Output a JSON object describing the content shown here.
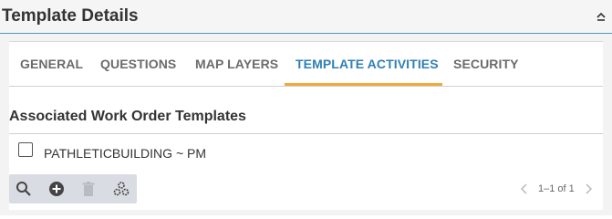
{
  "header": {
    "title": "Template Details",
    "collapse_icon": "chevron-up-icon"
  },
  "tabs": [
    {
      "label": "GENERAL",
      "active": false
    },
    {
      "label": "QUESTIONS",
      "active": false
    },
    {
      "label": "MAP LAYERS",
      "active": false
    },
    {
      "label": "TEMPLATE ACTIVITIES",
      "active": true
    },
    {
      "label": "SECURITY",
      "active": false
    }
  ],
  "section": {
    "title": "Associated Work Order Templates"
  },
  "rows": [
    {
      "label": "PATHLETICBUILDING ~ PM",
      "checked": false
    }
  ],
  "toolbar": {
    "icons": [
      "search-icon",
      "add-icon",
      "delete-icon",
      "settings-icon"
    ]
  },
  "pagination": {
    "text": "1–1 of 1"
  },
  "colors": {
    "accent": "#2f80b5",
    "tab_underline": "#f0a93c",
    "header_border": "#4a9bb8"
  }
}
